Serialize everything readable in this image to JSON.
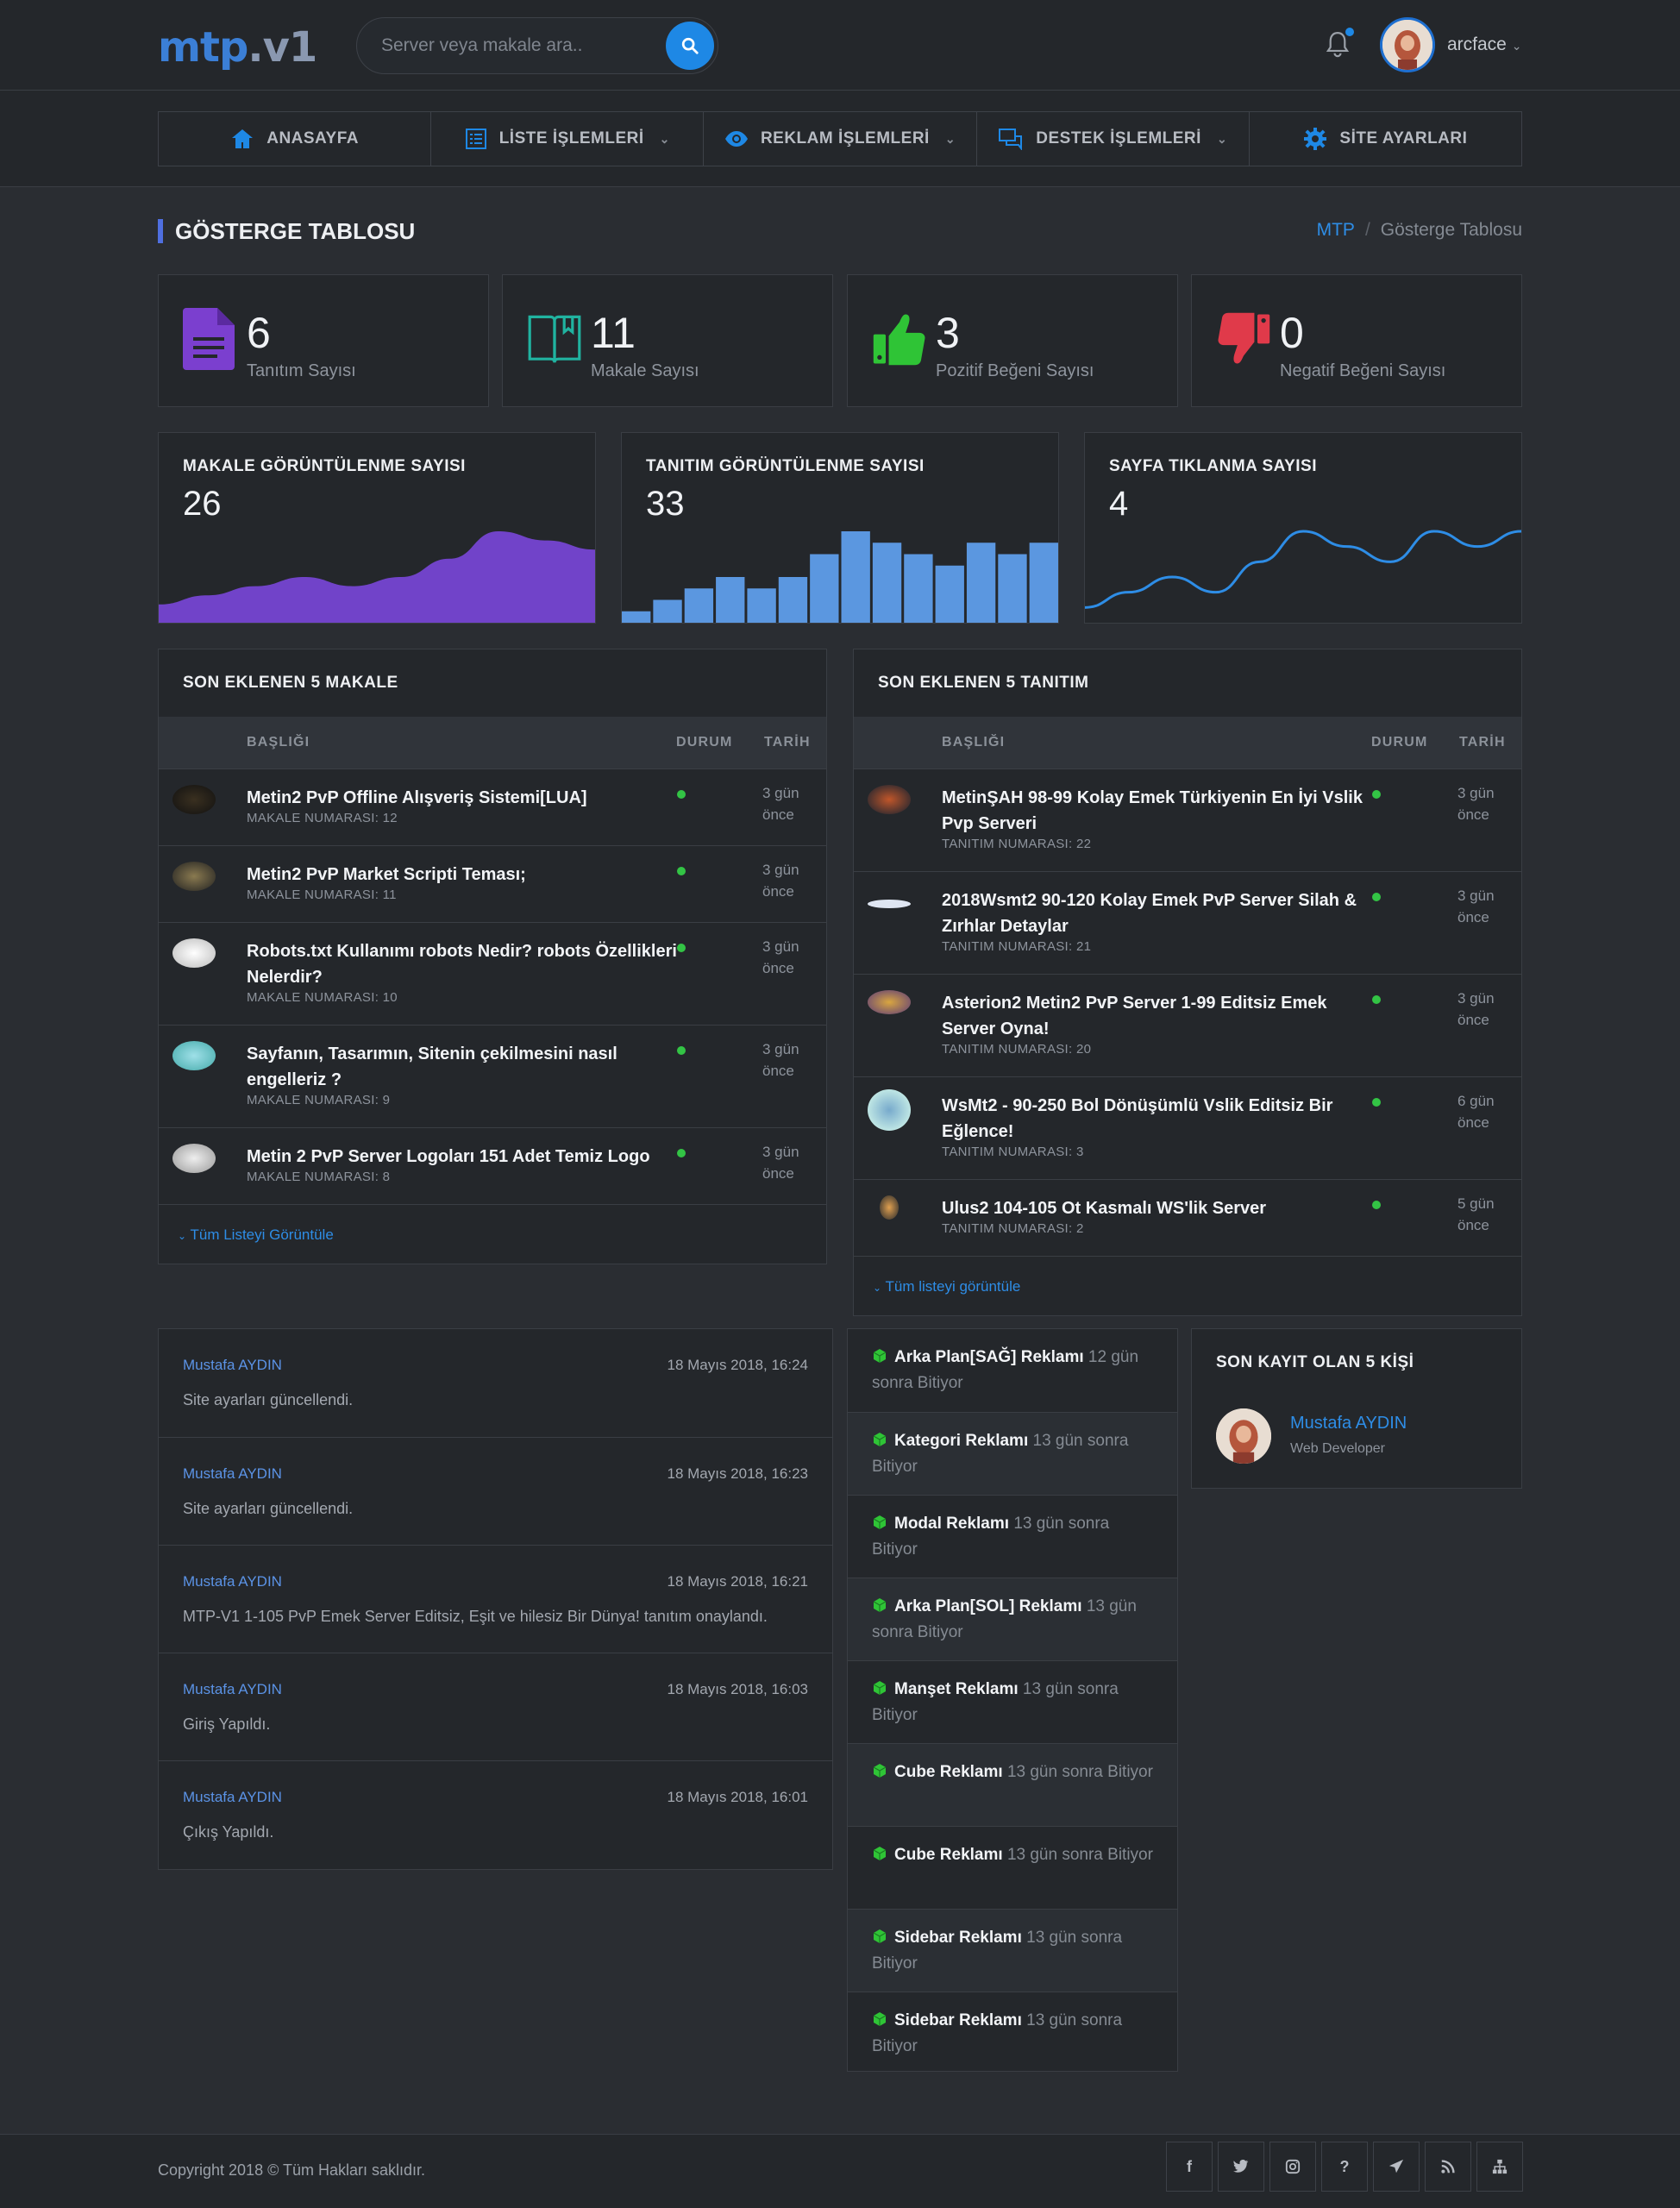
{
  "header": {
    "logo_part1": "mtp",
    "logo_part2": ".v1",
    "search_placeholder": "Server veya makale ara..",
    "username": "arcface"
  },
  "nav": {
    "home": "ANASAYFA",
    "list": "LİSTE İŞLEMLERİ",
    "ads": "REKLAM İŞLEMLERİ",
    "support": "DESTEK İŞLEMLERİ",
    "settings": "SİTE AYARLARI"
  },
  "page": {
    "title": "GÖSTERGE TABLOSU",
    "breadcrumb_root": "MTP",
    "breadcrumb_sep": "/",
    "breadcrumb_current": "Gösterge Tablosu"
  },
  "stats": [
    {
      "value": "6",
      "label": "Tanıtım Sayısı",
      "color": "#7b3fcf"
    },
    {
      "value": "11",
      "label": "Makale Sayısı",
      "color": "#20b3a0"
    },
    {
      "value": "3",
      "label": "Pozitif Beğeni Sayısı",
      "color": "#2fc436"
    },
    {
      "value": "0",
      "label": "Negatif Beğeni Sayısı",
      "color": "#e03a4a"
    }
  ],
  "mini_charts": [
    {
      "title": "MAKALE GÖRÜNTÜLENME SAYISI",
      "value": "26"
    },
    {
      "title": "TANITIM GÖRÜNTÜLENME SAYISI",
      "value": "33"
    },
    {
      "title": "SAYFA TIKLANMA SAYISI",
      "value": "4"
    }
  ],
  "chart_data": [
    {
      "type": "area",
      "title": "MAKALE GÖRÜNTÜLENME SAYISI",
      "color": "#7143c9",
      "values": [
        2,
        3,
        4,
        5,
        4,
        5,
        7,
        10,
        9,
        8
      ]
    },
    {
      "type": "bar",
      "title": "TANITIM GÖRÜNTÜLENME SAYISI",
      "color": "#5b97e0",
      "values": [
        1,
        2,
        3,
        4,
        3,
        4,
        6,
        8,
        7,
        6,
        5,
        7,
        6,
        7
      ]
    },
    {
      "type": "line",
      "title": "SAYFA TIKLANMA SAYISI",
      "color": "#2e8de6",
      "values": [
        1,
        2,
        3,
        2,
        4,
        6,
        5,
        4,
        6,
        5,
        6
      ]
    }
  ],
  "articles": {
    "title": "SON EKLENEN 5 MAKALE",
    "col_title": "BAŞLIĞI",
    "col_status": "DURUM",
    "col_date": "TARİH",
    "rows": [
      {
        "title": "Metin2 PvP Offline Alışveriş Sistemi[LUA]",
        "sub": "MAKALE NUMARASI: 12",
        "date1": "3 gün",
        "date2": "önce"
      },
      {
        "title": "Metin2 PvP Market Scripti Teması;",
        "sub": "MAKALE NUMARASI: 11",
        "date1": "3 gün",
        "date2": "önce"
      },
      {
        "title": "Robots.txt Kullanımı robots Nedir? robots Özellikleri",
        "title2": "Nelerdir?",
        "sub": "MAKALE NUMARASI: 10",
        "date1": "3 gün",
        "date2": "önce"
      },
      {
        "title": "Sayfanın, Tasarımın, Sitenin çekilmesini nasıl",
        "title2": "engelleriz ?",
        "sub": "MAKALE NUMARASI: 9",
        "date1": "3 gün",
        "date2": "önce"
      },
      {
        "title": "Metin 2 PvP Server Logoları 151 Adet Temiz Logo",
        "sub": "MAKALE NUMARASI: 8",
        "date1": "3 gün",
        "date2": "önce"
      }
    ],
    "footer_link": "Tüm Listeyi Görüntüle"
  },
  "promos": {
    "title": "SON EKLENEN 5 TANITIM",
    "col_title": "BAŞLIĞI",
    "col_status": "DURUM",
    "col_date": "TARİH",
    "rows": [
      {
        "title": "MetinŞAH 98-99 Kolay Emek Türkiyenin En İyi Vslik",
        "title2": "Pvp Serveri",
        "sub": "TANITIM NUMARASI: 22",
        "date1": "3 gün",
        "date2": "önce"
      },
      {
        "title": "2018Wsmt2 90-120 Kolay Emek PvP Server Silah &",
        "title2": "Zırhlar Detaylar",
        "sub": "TANITIM NUMARASI: 21",
        "date1": "3 gün",
        "date2": "önce"
      },
      {
        "title": "Asterion2 Metin2 PvP Server 1-99 Editsiz Emek",
        "title2": "Server Oyna!",
        "sub": "TANITIM NUMARASI: 20",
        "date1": "3 gün",
        "date2": "önce"
      },
      {
        "title": "WsMt2 - 90-250 Bol Dönüşümlü Vslik Editsiz Bir",
        "title2": "Eğlence!",
        "sub": "TANITIM NUMARASI: 3",
        "date1": "6 gün",
        "date2": "önce"
      },
      {
        "title": "Ulus2 104-105 Ot Kasmalı WS'lik Server",
        "sub": "TANITIM NUMARASI: 2",
        "date1": "5 gün",
        "date2": "önce"
      }
    ],
    "footer_link": "Tüm listeyi görüntüle"
  },
  "activity": [
    {
      "user": "Mustafa AYDIN",
      "time": "18 Mayıs 2018, 16:24",
      "msg": "Site ayarları güncellendi."
    },
    {
      "user": "Mustafa AYDIN",
      "time": "18 Mayıs 2018, 16:23",
      "msg": "Site ayarları güncellendi."
    },
    {
      "user": "Mustafa AYDIN",
      "time": "18 Mayıs 2018, 16:21",
      "msg": "MTP-V1 1-105 PvP Emek Server Editsiz, Eşit ve hilesiz Bir Dünya! tanıtım onaylandı."
    },
    {
      "user": "Mustafa AYDIN",
      "time": "18 Mayıs 2018, 16:03",
      "msg": "Giriş Yapıldı."
    },
    {
      "user": "Mustafa AYDIN",
      "time": "18 Mayıs 2018, 16:01",
      "msg": "Çıkış Yapıldı."
    }
  ],
  "ads": [
    {
      "name": "Arka Plan[SAĞ] Reklamı",
      "rest1": "12 gün",
      "rest2": "sonra Bitiyor"
    },
    {
      "name": "Kategori Reklamı",
      "rest1": "13 gün sonra",
      "rest2": "Bitiyor"
    },
    {
      "name": "Modal Reklamı",
      "rest1": "13 gün sonra",
      "rest2": "Bitiyor"
    },
    {
      "name": "Arka Plan[SOL] Reklamı",
      "rest1": "13 gün",
      "rest2": "sonra Bitiyor"
    },
    {
      "name": "Manşet Reklamı",
      "rest1": "13 gün sonra",
      "rest2": "Bitiyor"
    },
    {
      "name": "Cube Reklamı",
      "rest1": "13 gün sonra",
      "rest2": "Bitiyor"
    },
    {
      "name": "Cube Reklamı",
      "rest1": "13 gün sonra",
      "rest2": "Bitiyor"
    },
    {
      "name": "Sidebar Reklamı",
      "rest1": "13 gün sonra",
      "rest2": "Bitiyor"
    },
    {
      "name": "Sidebar Reklamı",
      "rest1": "13 gün sonra",
      "rest2": "Bitiyor"
    }
  ],
  "members": {
    "title": "SON KAYIT OLAN 5 KİŞİ",
    "items": [
      {
        "name": "Mustafa AYDIN",
        "role": "Web Developer"
      }
    ]
  },
  "footer": {
    "copyright": "Copyright 2018 © Tüm Hakları saklıdır.",
    "icons": [
      "facebook-icon",
      "twitter-icon",
      "instagram-icon",
      "help-icon",
      "rocket-icon",
      "rss-icon",
      "sitemap-icon"
    ],
    "help_glyph": "?"
  }
}
